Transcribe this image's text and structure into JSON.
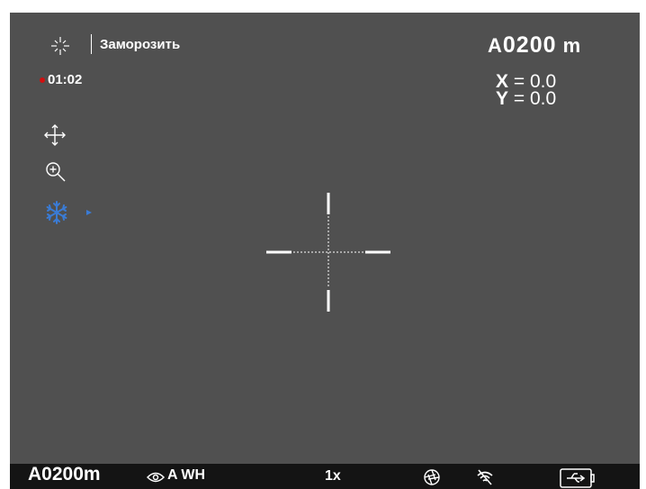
{
  "header": {
    "menu_title": "Заморозить",
    "record_time": "01:02",
    "range_prefix": "A",
    "range_value": "0200",
    "range_unit": "m"
  },
  "coords": {
    "x_label": "X",
    "x_value": "= 0.0",
    "y_label": "Y",
    "y_value": "= 0.0"
  },
  "menu": {
    "items": [
      {
        "icon": "move-arrows-icon"
      },
      {
        "icon": "zoom-in-icon"
      },
      {
        "icon": "snowflake-icon",
        "active": true
      }
    ]
  },
  "status_bar": {
    "range_prefix": "A",
    "range_value": "0200",
    "range_unit": "m",
    "mode_prefix": "A",
    "mode_value": "WH",
    "zoom": "1x"
  },
  "colors": {
    "screen_bg": "#505050",
    "accent_blue": "#3a7bd5",
    "record_red": "#d01010"
  }
}
